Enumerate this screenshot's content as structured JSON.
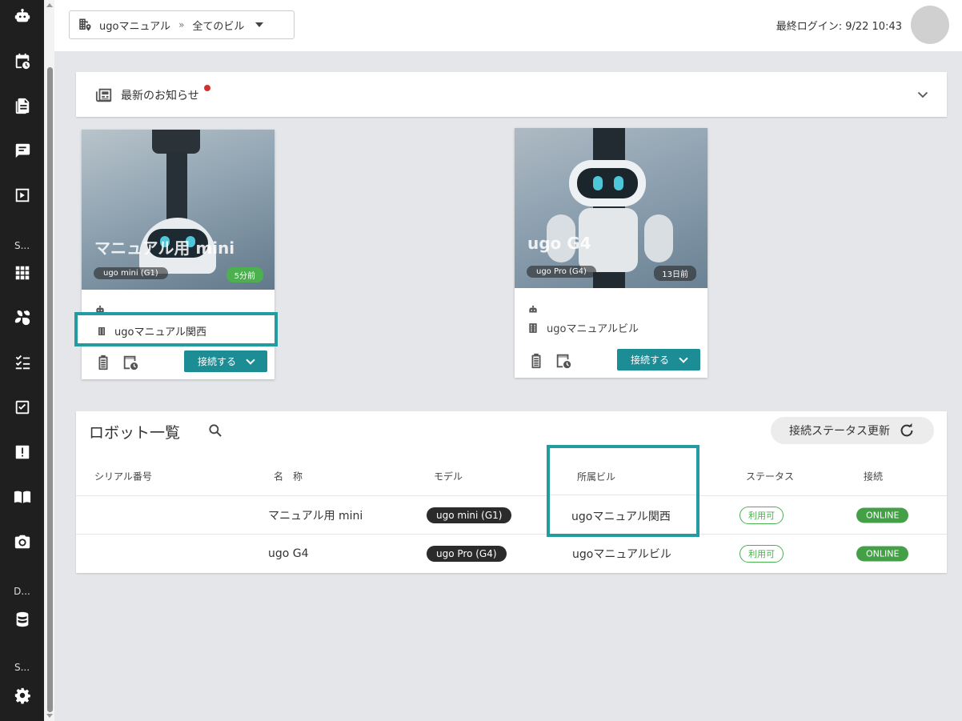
{
  "sidebar": {
    "sections": [
      "S...",
      "D...",
      "S..."
    ],
    "icons": [
      "robot-icon",
      "calendar-clock-icon",
      "document-icon",
      "chat-icon",
      "play-icon",
      "grid-icon",
      "fan-icon",
      "checklist-icon",
      "task-check-icon",
      "alert-icon",
      "manual-book-icon",
      "camera-icon",
      "database-icon",
      "settings-icon"
    ]
  },
  "header": {
    "breadcrumb_root": "ugoマニュアル",
    "breadcrumb_sep": "»",
    "breadcrumb_current": "全てのビル",
    "last_login": "最終ログイン: 9/22 10:43"
  },
  "news": {
    "title": "最新のお知らせ"
  },
  "cards": [
    {
      "name": "マニュアル用 mini",
      "model": "ugo mini (G1)",
      "time": "5分前",
      "building": "ugoマニュアル関西",
      "connect_label": "接続する"
    },
    {
      "name": "ugo G4",
      "model": "ugo Pro (G4)",
      "time": "13日前",
      "building": "ugoマニュアルビル",
      "connect_label": "接続する"
    }
  ],
  "robot_list": {
    "title": "ロボット一覧",
    "refresh_label": "接続ステータス更新",
    "columns": [
      "シリアル番号",
      "名　称",
      "モデル",
      "所属ビル",
      "ステータス",
      "接続"
    ],
    "rows": [
      {
        "serial": "",
        "name": "マニュアル用 mini",
        "model": "ugo mini (G1)",
        "building": "ugoマニュアル関西",
        "status": "利用可",
        "connection": "ONLINE"
      },
      {
        "serial": "",
        "name": "ugo G4",
        "model": "ugo Pro (G4)",
        "building": "ugoマニュアルビル",
        "status": "利用可",
        "connection": "ONLINE"
      }
    ]
  },
  "colors": {
    "accent": "#1c8c95",
    "highlight": "#229ca0",
    "online": "#43a047",
    "sidebar": "#1f1f1f"
  }
}
